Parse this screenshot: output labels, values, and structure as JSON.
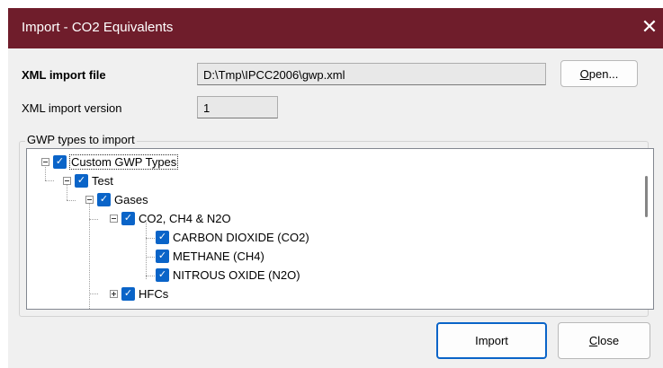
{
  "window": {
    "title": "Import - CO2 Equivalents",
    "close_glyph": "✕"
  },
  "xml_file": {
    "label": "XML import file",
    "value": "D:\\Tmp\\IPCC2006\\gwp.xml",
    "open_button": {
      "prefix": "",
      "accel": "O",
      "rest": "pen..."
    }
  },
  "xml_version": {
    "label": "XML import version",
    "value": "1"
  },
  "gwp": {
    "group_label": "GWP types to import",
    "tree": [
      {
        "label": "Custom GWP Types",
        "checked": true,
        "expander": "expanded",
        "selected": true
      },
      {
        "label": "Test",
        "checked": true,
        "expander": "expanded"
      },
      {
        "label": "Gases",
        "checked": true,
        "expander": "expanded"
      },
      {
        "label": "CO2, CH4 & N2O",
        "checked": true,
        "expander": "expanded"
      },
      {
        "label": "CARBON DIOXIDE (CO2)",
        "checked": true
      },
      {
        "label": "METHANE (CH4)",
        "checked": true
      },
      {
        "label": "NITROUS OXIDE (N2O)",
        "checked": true
      },
      {
        "label": "HFCs",
        "checked": true,
        "expander": "collapsed"
      }
    ]
  },
  "buttons": {
    "import": "Import",
    "close": {
      "accel": "C",
      "rest": "lose"
    }
  },
  "icons": {
    "checkbox": "checkmark-icon",
    "expander_expanded": "minus-box-icon",
    "expander_collapsed": "plus-box-icon"
  },
  "colors": {
    "titlebar": "#6f1d2b",
    "accent": "#0a64c8"
  }
}
